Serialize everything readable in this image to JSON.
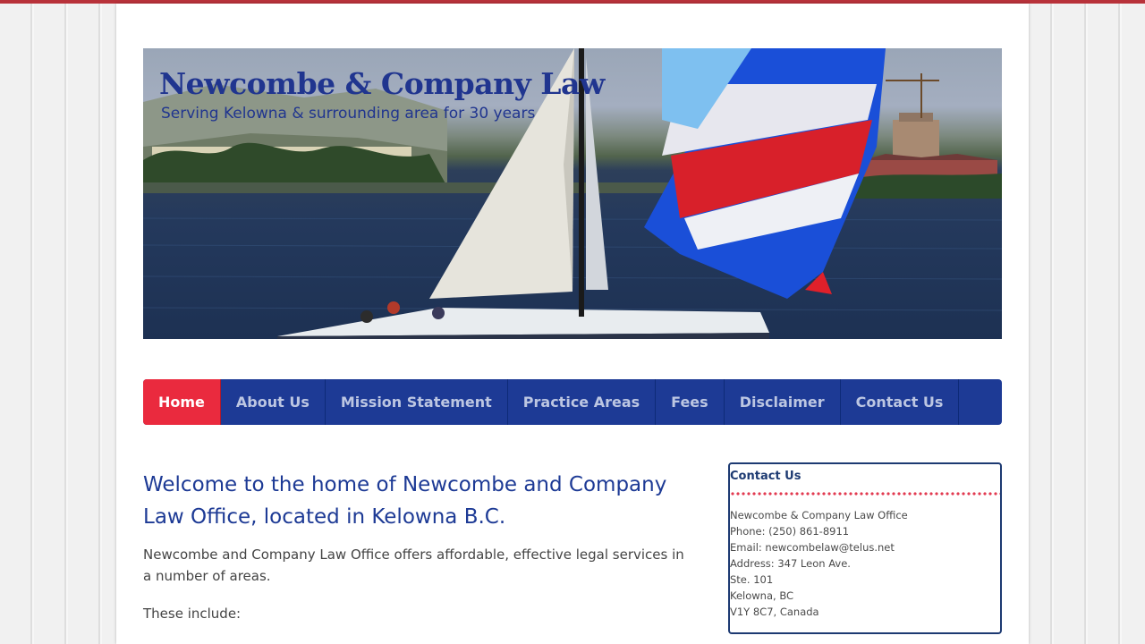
{
  "site": {
    "title": "Newcombe & Company Law",
    "tagline": "Serving Kelowna & surrounding area for 30 years"
  },
  "nav": {
    "items": [
      {
        "label": "Home",
        "active": true
      },
      {
        "label": "About Us"
      },
      {
        "label": "Mission Statement"
      },
      {
        "label": "Practice Areas"
      },
      {
        "label": "Fees"
      },
      {
        "label": "Disclaimer"
      },
      {
        "label": "Contact Us"
      }
    ]
  },
  "main": {
    "heading": "Welcome to the home of Newcombe and Company Law Office, located in Kelowna B.C.",
    "intro": "Newcombe and Company Law Office offers affordable, effective  legal services in a number of areas.",
    "these_include": "These include:"
  },
  "contact": {
    "title": "Contact Us",
    "lines": [
      "Newcombe & Company Law Office",
      "Phone: (250) 861-8911",
      "Email: newcombelaw@telus.net",
      "Address: 347 Leon Ave.",
      "Ste. 101",
      "Kelowna, BC",
      "V1Y 8C7, Canada"
    ]
  },
  "colors": {
    "nav_bg": "#1d3a95",
    "nav_active": "#ea2a3e",
    "heading": "#1d3a95",
    "accent_red": "#b8323a"
  }
}
